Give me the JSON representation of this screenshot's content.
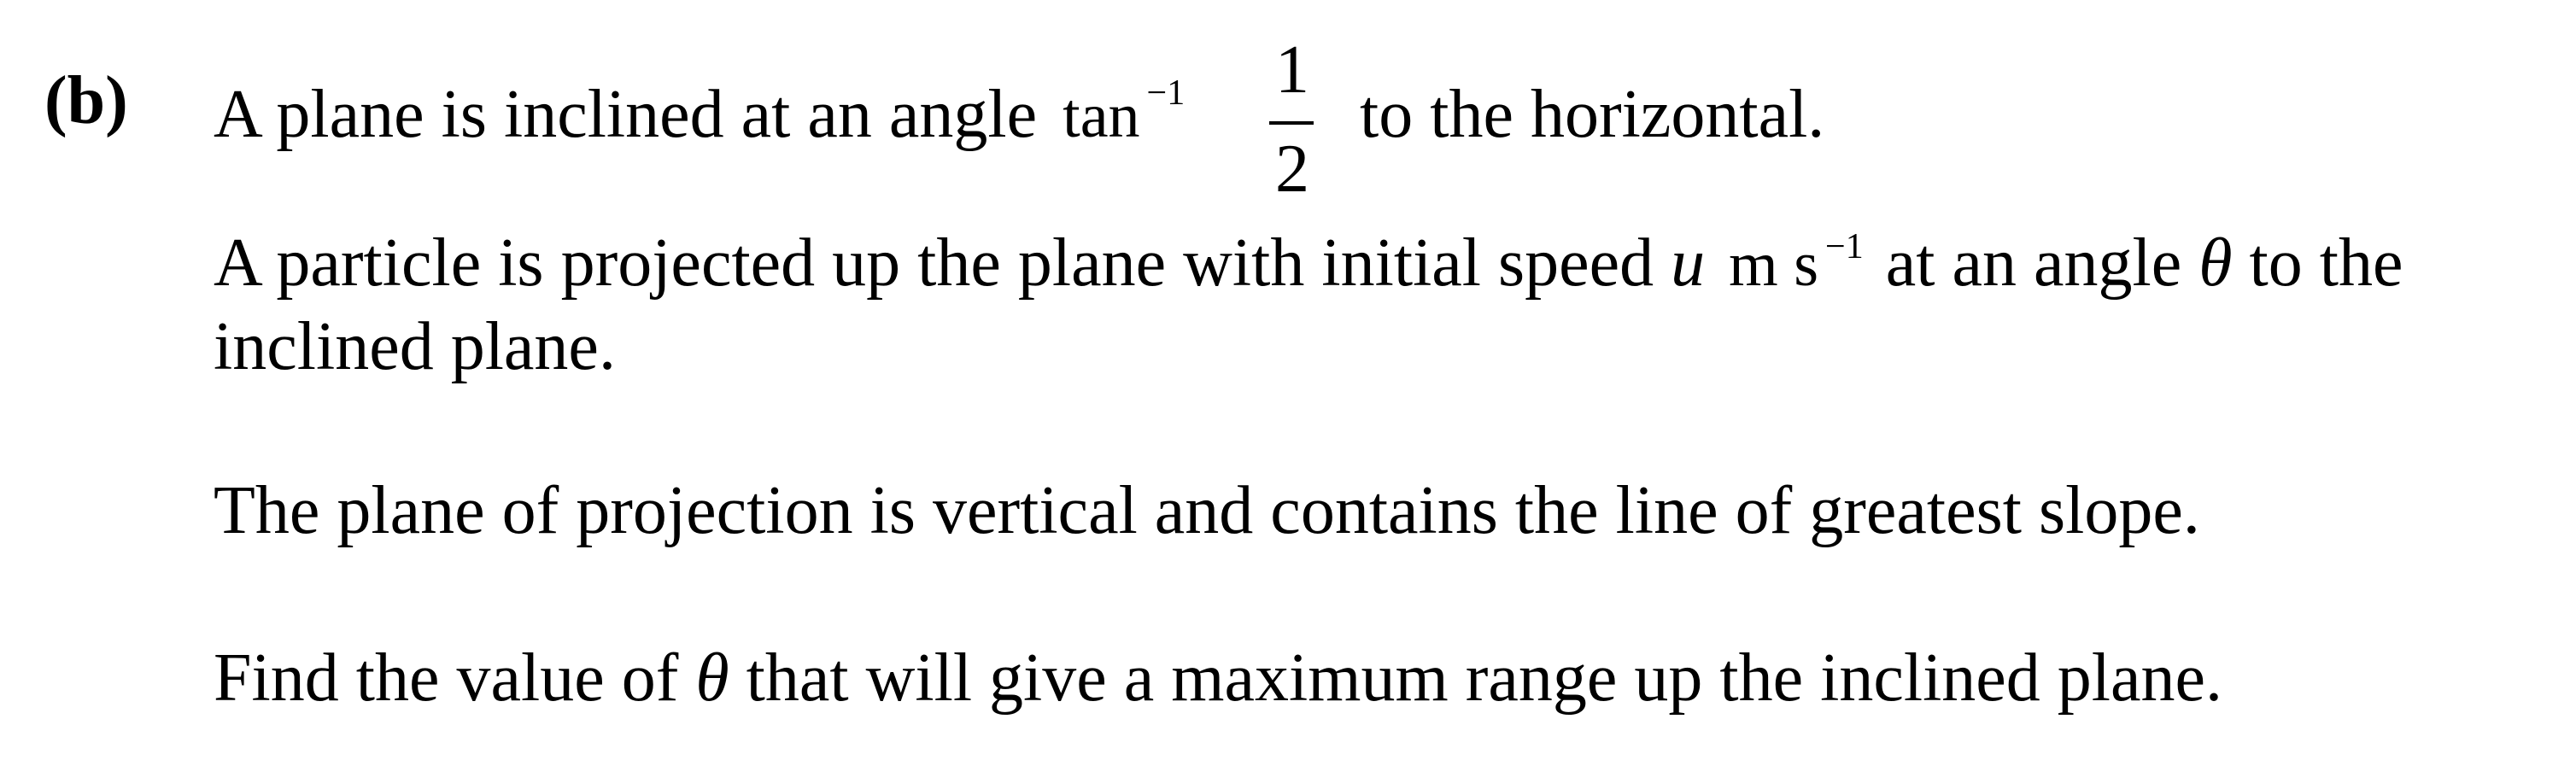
{
  "question": {
    "part_label": "(b)",
    "line1": {
      "lead": "A plane is inclined at an angle",
      "tan": "tan",
      "tan_exponent": "−1",
      "fraction_numerator": "1",
      "fraction_denominator": "2",
      "tail": "to the horizontal."
    },
    "line2": {
      "lead": "A particle is projected up the plane with initial speed",
      "speed_var": "u",
      "units": "m s",
      "units_exponent": "−1",
      "middle": "at an angle",
      "angle_var": "θ",
      "tail": "to the"
    },
    "line3": "inclined plane.",
    "line4": "The plane of projection is vertical and contains the line of greatest slope.",
    "line5": {
      "lead": "Find the value of",
      "angle_var": "θ",
      "tail": "that will give a maximum range up the inclined plane."
    }
  }
}
